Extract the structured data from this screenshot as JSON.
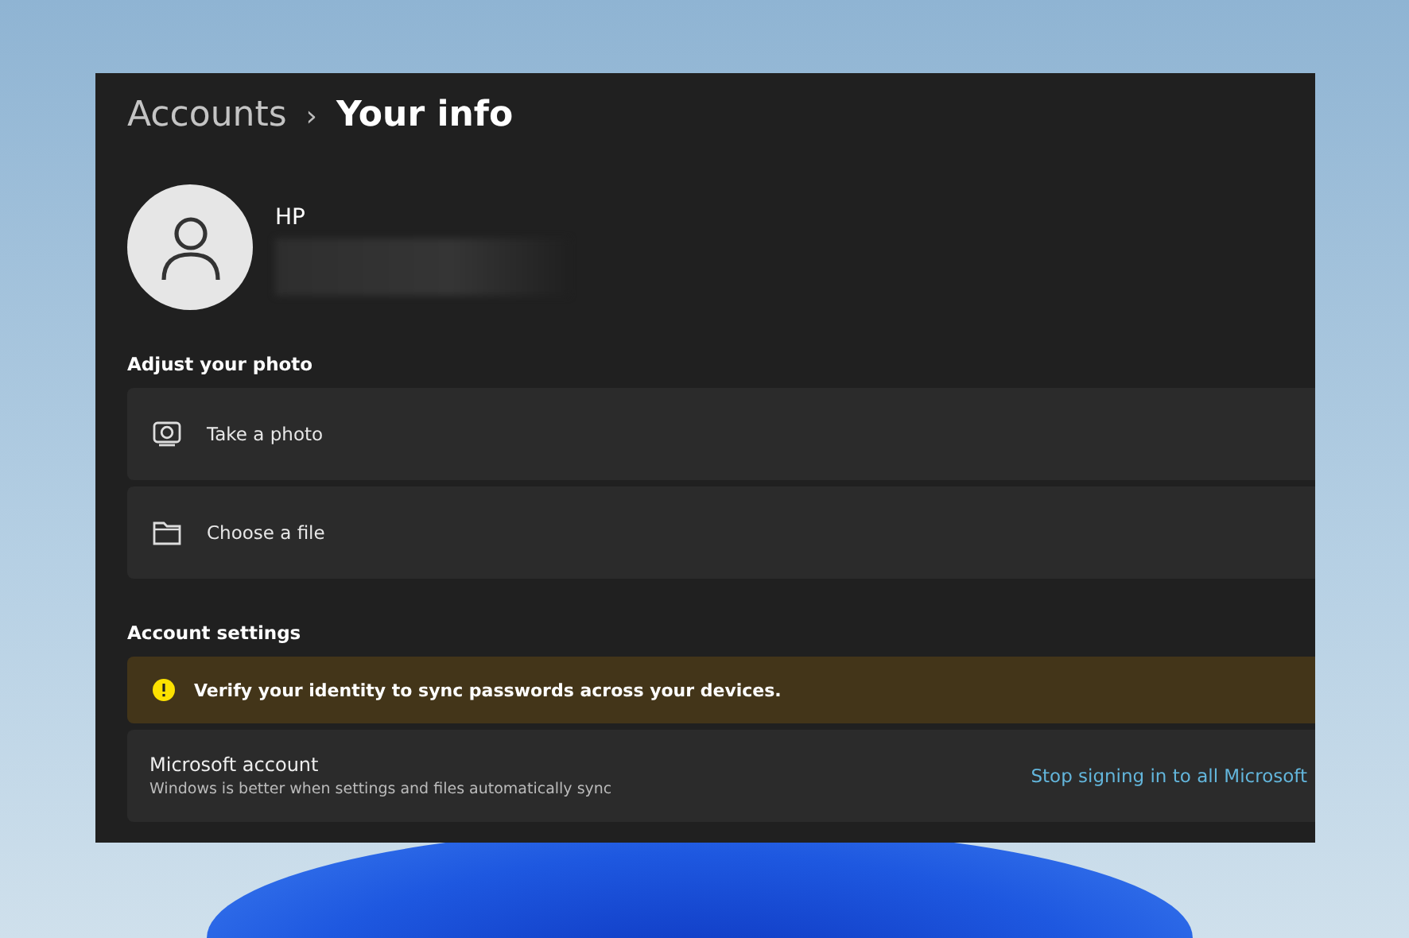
{
  "breadcrumb": {
    "parent": "Accounts",
    "separator": "›",
    "current": "Your info"
  },
  "profile": {
    "name": "HP"
  },
  "sections": [
    {
      "heading": "Adjust your photo",
      "rows": [
        {
          "kind": "camera",
          "label": "Take a photo"
        },
        {
          "kind": "folder",
          "label": "Choose a file"
        }
      ]
    },
    {
      "heading": "Account settings",
      "rows": [
        {
          "kind": "warning",
          "label": "Verify your identity to sync passwords across your devices."
        },
        {
          "kind": "account",
          "label": "Microsoft account",
          "description": "Windows is better when settings and files automatically sync",
          "link": "Stop signing in to all Microsoft"
        }
      ]
    }
  ]
}
